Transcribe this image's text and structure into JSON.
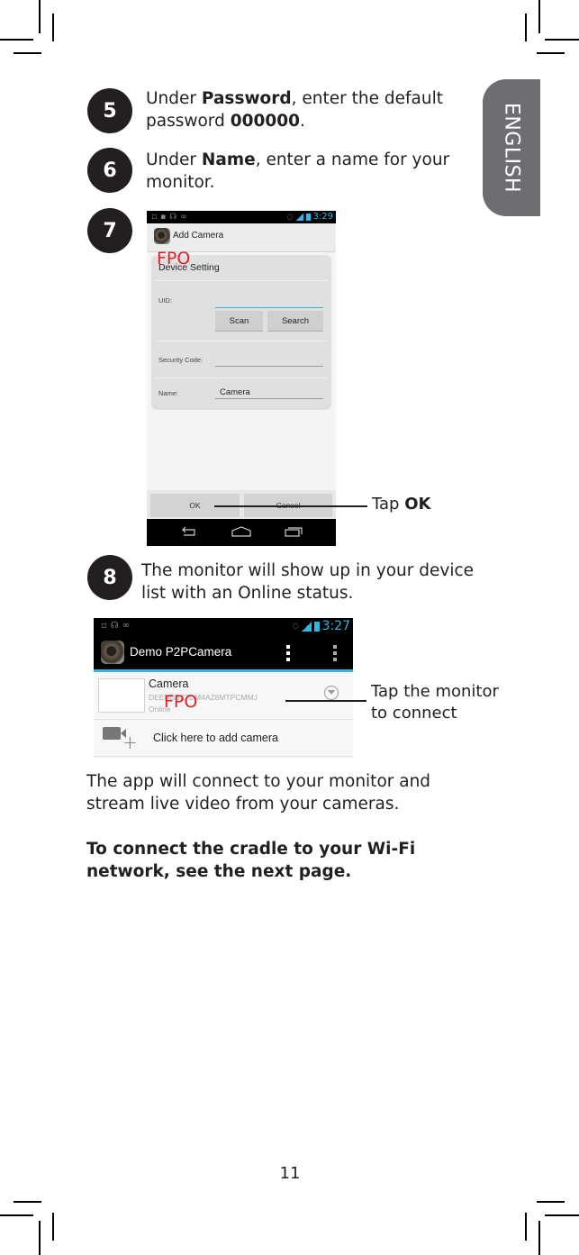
{
  "language_tab": "ENGLISH",
  "steps": [
    {
      "number": "5",
      "parts": [
        {
          "text": "Under ",
          "bold": false
        },
        {
          "text": "Password",
          "bold": true
        },
        {
          "text": ", enter the default password ",
          "bold": false
        },
        {
          "text": "000000",
          "bold": true
        },
        {
          "text": ".",
          "bold": false
        }
      ]
    },
    {
      "number": "6",
      "parts": [
        {
          "text": "Under ",
          "bold": false
        },
        {
          "text": "Name",
          "bold": true
        },
        {
          "text": ", enter a name for your monitor.",
          "bold": false
        }
      ]
    },
    {
      "number": "7"
    },
    {
      "number": "8",
      "text": "The monitor will show up in your device list with an Online status."
    }
  ],
  "add_camera_screen": {
    "status_time": "3:29",
    "title": "Add Camera",
    "section_header": "Device Setting",
    "uid_label": "UID:",
    "uid_value": "",
    "scan_button": "Scan",
    "search_button": "Search",
    "security_code_label": "Security Code:",
    "security_code_value": "",
    "name_label": "Name:",
    "name_value": "Camera",
    "ok_button": "OK",
    "cancel_button": "Cancel",
    "watermark": "FPO"
  },
  "callout_ok": {
    "prefix": "Tap ",
    "bold": "OK"
  },
  "device_list_screen": {
    "status_time": "3:27",
    "title": "Demo P2PCamera",
    "device": {
      "name": "Camera",
      "uid": "DEEHBSZ7DM4AZ8MTPCMMJ",
      "status": "Online"
    },
    "add_camera_label": "Click here to add camera",
    "watermark": "FPO"
  },
  "callout_monitor": {
    "line1": "Tap the monitor",
    "line2": "to connect"
  },
  "body_text": "The app will connect to your monitor and stream live video from your cameras.",
  "body_bold": "To connect the cradle to your Wi-Fi network, see the next page.",
  "page_number": "11",
  "colors": {
    "accent_blue": "#33b5e5",
    "fpo_red": "#e21f26",
    "tab_gray": "#6d6e71"
  }
}
